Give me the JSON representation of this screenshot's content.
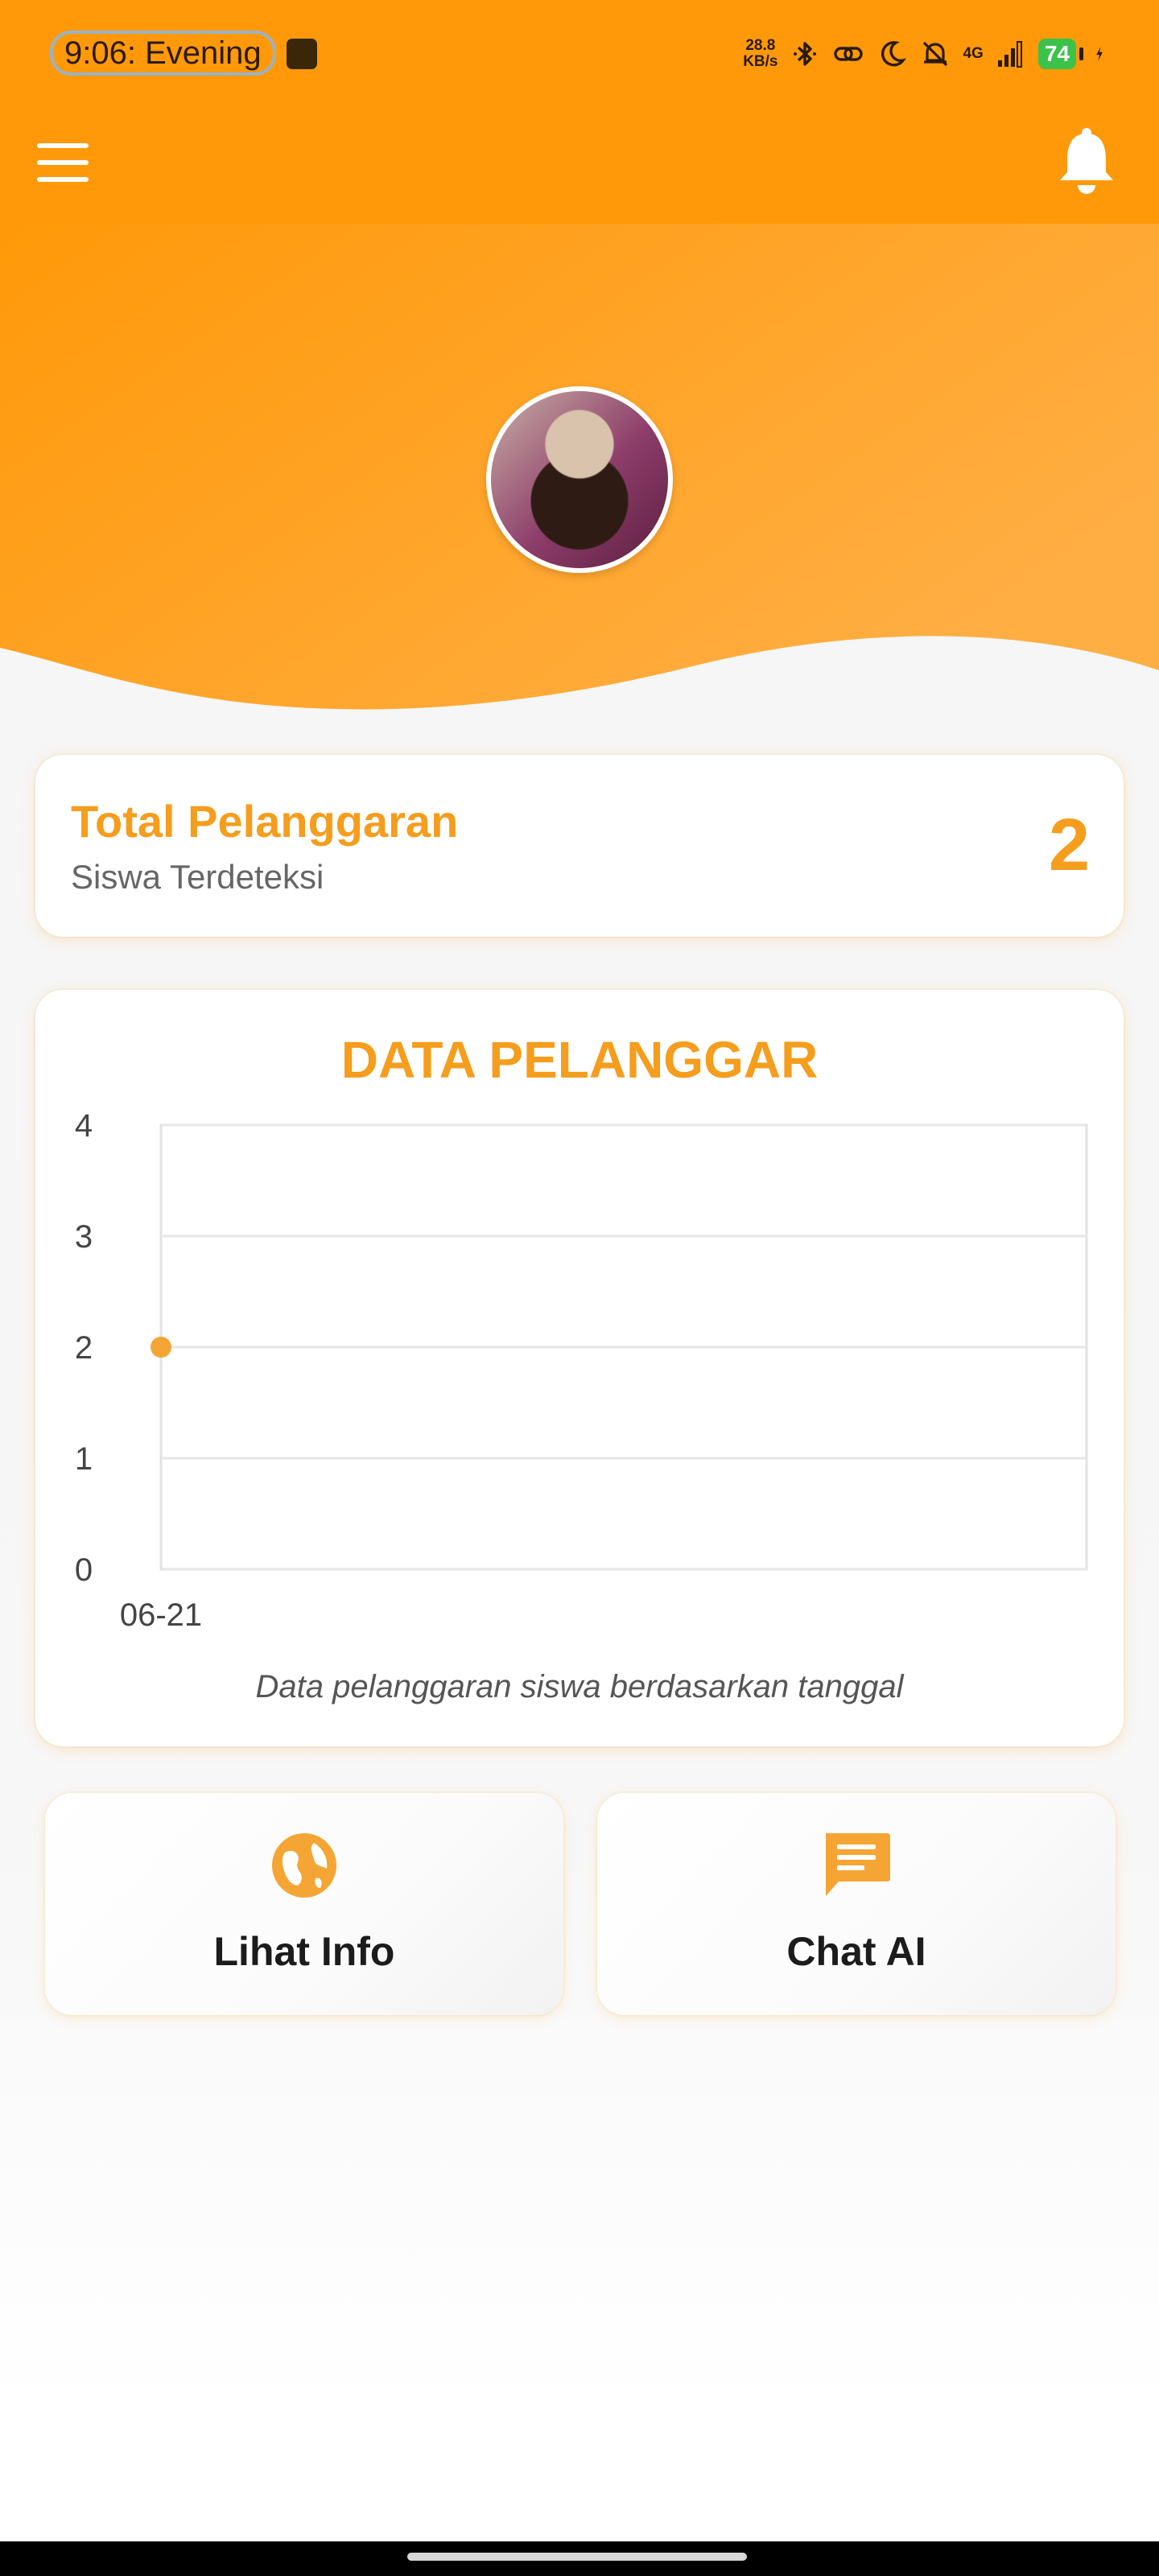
{
  "status_bar": {
    "time": "9:06:  Evening",
    "net_speed_value": "28.8",
    "net_speed_unit": "KB/s",
    "network_label": "4G",
    "battery": "74"
  },
  "header": {
    "menu_icon": "hamburger-menu-icon",
    "notification_icon": "bell-icon"
  },
  "summary": {
    "title": "Total Pelanggaran",
    "subtitle": "Siswa Terdeteksi",
    "count": "2"
  },
  "chart": {
    "title": "DATA PELANGGAR",
    "caption": "Data pelanggaran siswa berdasarkan tanggal"
  },
  "chart_data": {
    "type": "line",
    "title": "DATA PELANGGAR",
    "x": [
      "06-21"
    ],
    "series": [
      {
        "values": [
          2
        ]
      }
    ],
    "ylim": [
      0,
      4
    ],
    "yticks": [
      0,
      1,
      2,
      3,
      4
    ],
    "grid": true,
    "point_color": "#f5a534"
  },
  "actions": {
    "info_label": "Lihat Info",
    "info_icon": "globe-icon",
    "chat_label": "Chat AI",
    "chat_icon": "chat-bubble-icon"
  },
  "colors": {
    "primary": "#ff9909",
    "accent_text": "#f59d1d"
  }
}
